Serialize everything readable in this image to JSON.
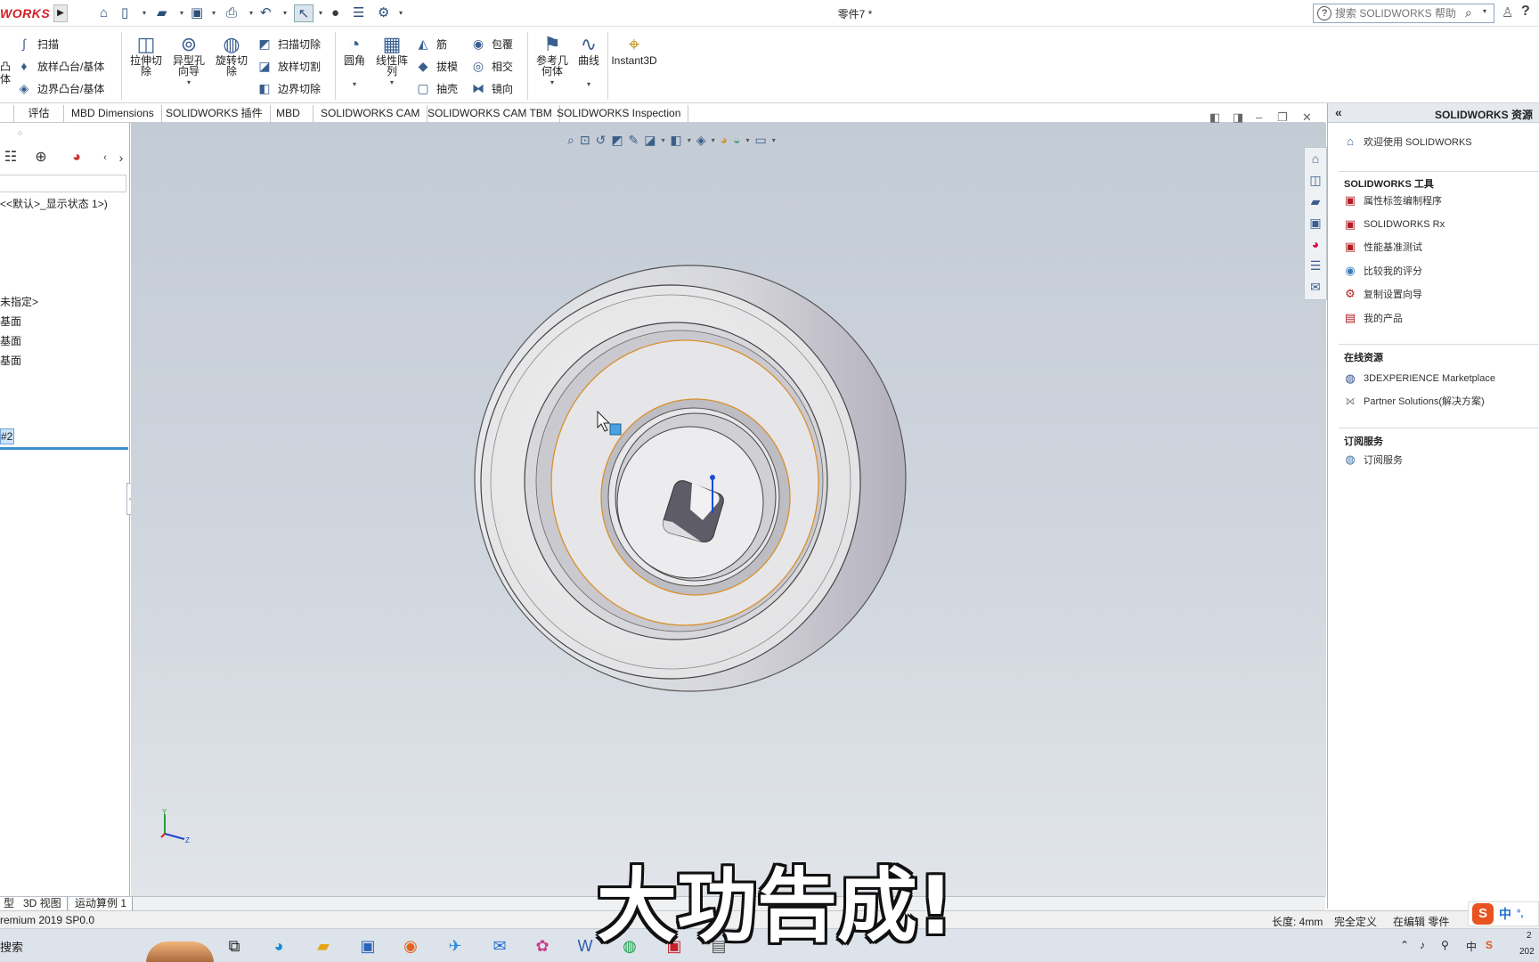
{
  "app": {
    "logo": "WORKS",
    "doc_title": "零件7 *",
    "search_placeholder": "搜索 SOLIDWORKS 帮助"
  },
  "commands": {
    "sweep": "扫描",
    "loft_boss": "放样凸台/基体",
    "boundary_boss": "边界凸台/基体",
    "left_cut_label_1": "凸",
    "left_cut_label_2": "体",
    "extruded_cut": "拉伸切\n除",
    "hole_wizard": "异型孔\n向导",
    "revolved_cut": "旋转切\n除",
    "swept_cut": "扫描切除",
    "lofted_cut": "放样切割",
    "boundary_cut": "边界切除",
    "fillet": "圆角",
    "linear_pattern": "线性阵\n列",
    "rib": "筋",
    "draft": "拔模",
    "shell": "抽壳",
    "wrap": "包覆",
    "intersect": "相交",
    "mirror": "镜向",
    "ref_geometry": "参考几\n何体",
    "curves": "曲线",
    "instant3d": "Instant3D"
  },
  "tabs": [
    "评估",
    "MBD Dimensions",
    "SOLIDWORKS 插件",
    "MBD",
    "SOLIDWORKS CAM",
    "SOLIDWORKS CAM TBM",
    "SOLIDWORKS Inspection"
  ],
  "feature_tree": {
    "config": "<<默认>_显示状态 1>)",
    "material": "未指定>",
    "plane1": "基面",
    "plane2": "基面",
    "plane3": "基面",
    "selected": "#2"
  },
  "task_pane": {
    "title": "SOLIDWORKS 资源",
    "welcome": "欢迎使用  SOLIDWORKS",
    "tools_heading": "SOLIDWORKS 工具",
    "tools": [
      "属性标签编制程序",
      "SOLIDWORKS Rx",
      "性能基准测试",
      "比较我的评分",
      "复制设置向导",
      "我的产品"
    ],
    "online_heading": "在线资源",
    "online": [
      "3DEXPERIENCE Marketplace",
      "Partner Solutions(解决方案)"
    ],
    "subscription_heading": "订阅服务",
    "subscription": [
      "订阅服务"
    ]
  },
  "model_tabs": [
    "型",
    "3D 视图",
    "运动算例 1"
  ],
  "status": {
    "version": "remium 2019 SP0.0",
    "length": "长度: 4mm",
    "defined": "完全定义",
    "editing": "在编辑 零件"
  },
  "taskbar": {
    "search": "搜索",
    "tray_lang": "中",
    "clock_top": "2",
    "clock_bottom": "202"
  },
  "caption": "大功告成!",
  "ime": {
    "logo": "S",
    "lang": "中"
  },
  "triad": {
    "y": "Y",
    "z": "Z"
  },
  "colors": {
    "accent": "#3a8fd0",
    "brand": "#d21f26",
    "edge_highlight": "#d9902f"
  }
}
